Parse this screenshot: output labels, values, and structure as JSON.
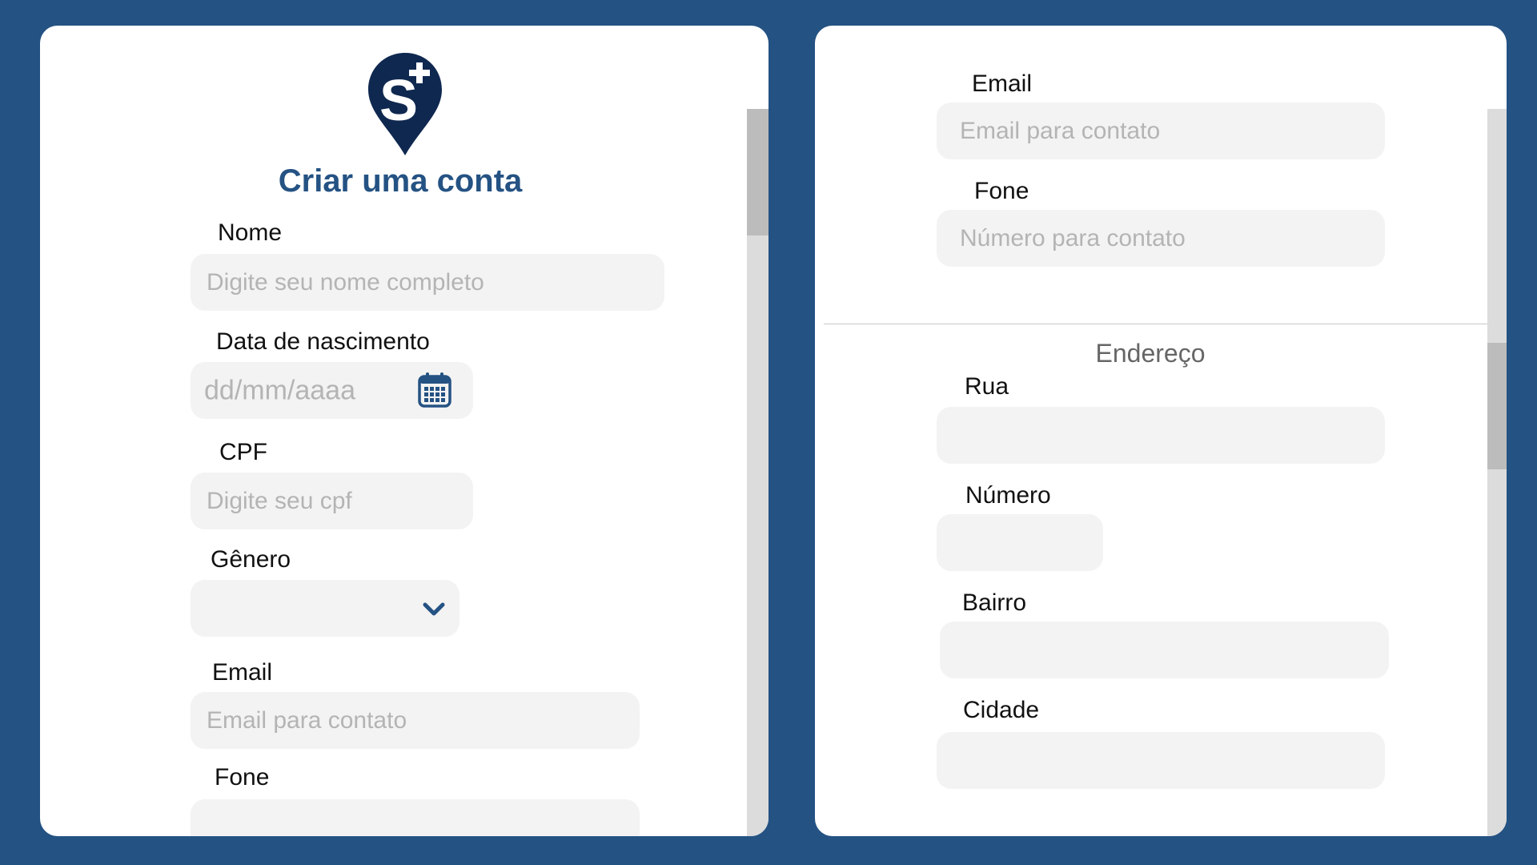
{
  "left_panel": {
    "title": "Criar uma conta",
    "logo": {
      "icon": "map-pin-plus-logo",
      "letter": "S",
      "color": "#0f2850"
    },
    "fields": {
      "nome": {
        "label": "Nome",
        "placeholder": "Digite seu nome completo"
      },
      "nascimento": {
        "label": "Data de nascimento",
        "placeholder": "dd/mm/aaaa",
        "icon": "calendar-icon"
      },
      "cpf": {
        "label": "CPF",
        "placeholder": "Digite seu cpf"
      },
      "genero": {
        "label": "Gênero",
        "value": "",
        "icon": "chevron-down-icon"
      },
      "email": {
        "label": "Email",
        "placeholder": "Email para contato"
      },
      "fone": {
        "label": "Fone",
        "placeholder": ""
      }
    }
  },
  "right_panel": {
    "fields": {
      "email": {
        "label": "Email",
        "placeholder": "Email para contato"
      },
      "fone": {
        "label": "Fone",
        "placeholder": "Número para contato"
      }
    },
    "address": {
      "section_title": "Endereço",
      "rua": {
        "label": "Rua",
        "value": ""
      },
      "numero": {
        "label": "Número",
        "value": ""
      },
      "bairro": {
        "label": "Bairro",
        "value": ""
      },
      "cidade": {
        "label": "Cidade",
        "value": ""
      }
    }
  },
  "colors": {
    "background": "#245283",
    "accent": "#245283",
    "logo": "#0f2850",
    "field_bg": "#f3f3f3",
    "placeholder": "#b4b4b4"
  }
}
